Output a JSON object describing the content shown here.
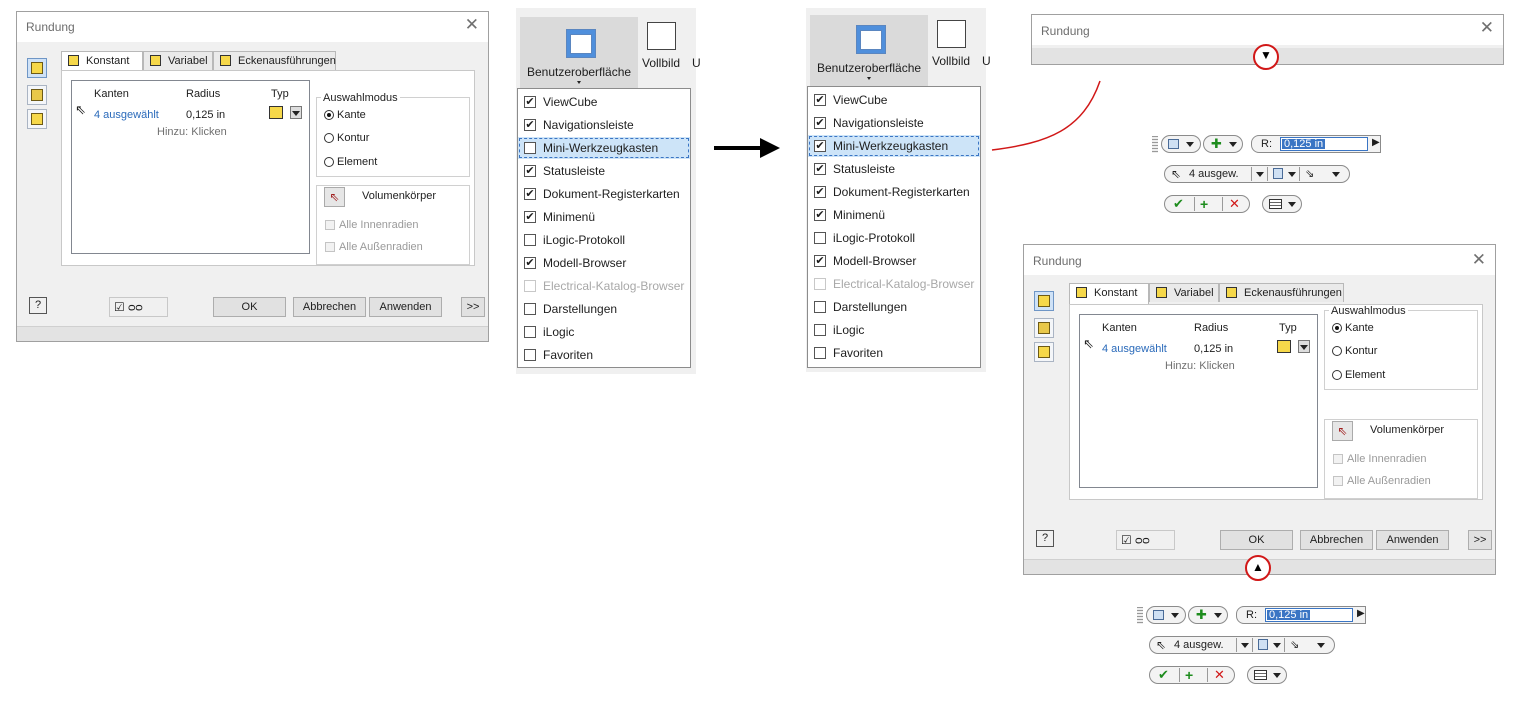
{
  "dialog": {
    "title": "Rundung",
    "close": "✕",
    "tabs": [
      "Konstant",
      "Variabel",
      "Eckenausführungen"
    ],
    "grid": {
      "headers": [
        "Kanten",
        "Radius",
        "Typ"
      ],
      "row_edges": "4 ausgewählt",
      "row_radius": "0,125 in",
      "add_hint": "Hinzu: Klicken"
    },
    "selection_mode": {
      "label": "Auswahlmodus",
      "options": [
        "Kante",
        "Kontur",
        "Element"
      ],
      "selected": "Kante"
    },
    "solid": {
      "label": "Volumenkörper"
    },
    "checks": [
      "Alle Innenradien",
      "Alle Außenradien"
    ],
    "buttons": {
      "ok": "OK",
      "cancel": "Abbrechen",
      "apply": "Anwenden",
      "more": ">>",
      "help": "?"
    }
  },
  "menu": {
    "ribbon_label": "Benutzeroberfläche",
    "fullscreen_label": "Vollbild",
    "ribbon_cut": "U",
    "items": [
      {
        "label": "ViewCube",
        "checked": true,
        "disabled": false
      },
      {
        "label": "Navigationsleiste",
        "checked": true,
        "disabled": false
      },
      {
        "label": "Mini-Werkzeugkasten",
        "checked": false,
        "disabled": false
      },
      {
        "label": "Statusleiste",
        "checked": true,
        "disabled": false
      },
      {
        "label": "Dokument-Registerkarten",
        "checked": true,
        "disabled": false
      },
      {
        "label": "Minimenü",
        "checked": true,
        "disabled": false
      },
      {
        "label": "iLogic-Protokoll",
        "checked": false,
        "disabled": false
      },
      {
        "label": "Modell-Browser",
        "checked": true,
        "disabled": false
      },
      {
        "label": "Electrical-Katalog-Browser",
        "checked": false,
        "disabled": true
      },
      {
        "label": "Darstellungen",
        "checked": false,
        "disabled": false
      },
      {
        "label": "iLogic",
        "checked": false,
        "disabled": false
      },
      {
        "label": "Favoriten",
        "checked": false,
        "disabled": false
      }
    ],
    "highlighted": "Mini-Werkzeugkasten",
    "highlighted_checked_after": true
  },
  "minitoolbar": {
    "r_label": "R:",
    "r_value": "0,125 in",
    "edges_label": "4 ausgew."
  },
  "colors": {
    "accent": "#3a75c4",
    "highlight": "#cde4f8",
    "annotation_red": "#d11818"
  },
  "icons": [
    "cube-icon",
    "help-icon",
    "glasses-icon",
    "cursor-icon",
    "check-icon",
    "plus-icon",
    "cross-icon",
    "arrow-right-icon",
    "triangle-down-icon",
    "triangle-up-icon"
  ]
}
